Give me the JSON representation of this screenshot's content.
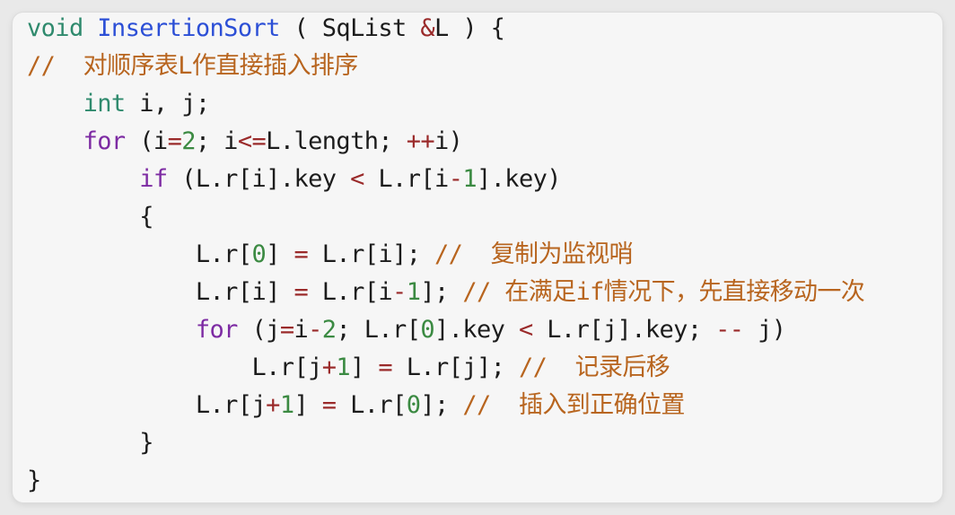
{
  "palette": {
    "keyword": "#7d2ba3",
    "type": "#2f8a6d",
    "function": "#2c4fd6",
    "number": "#3b8a42",
    "operator": "#9a2a2a",
    "comment": "#b8651f",
    "plain": "#1c1c1c",
    "background": "#f6f6f6"
  },
  "code": {
    "lines": [
      [
        [
          "void",
          "type"
        ],
        [
          " ",
          ""
        ],
        [
          "InsertionSort",
          "fn"
        ],
        [
          " ( SqList ",
          ""
        ],
        [
          "&",
          "op"
        ],
        [
          "L ) {",
          ""
        ]
      ],
      [
        [
          "//  对顺序表L作直接插入排序",
          "cm"
        ]
      ],
      [
        [
          "    ",
          ""
        ],
        [
          "int",
          "type"
        ],
        [
          " i, j;",
          ""
        ]
      ],
      [
        [
          "    ",
          ""
        ],
        [
          "for",
          "kw"
        ],
        [
          " (i",
          ""
        ],
        [
          "=",
          "op"
        ],
        [
          "2",
          "num"
        ],
        [
          "; i",
          ""
        ],
        [
          "<=",
          "op"
        ],
        [
          "L.length; ",
          ""
        ],
        [
          "++",
          "op"
        ],
        [
          "i)",
          ""
        ]
      ],
      [
        [
          "        ",
          ""
        ],
        [
          "if",
          "kw"
        ],
        [
          " (L.r[i].key ",
          ""
        ],
        [
          "<",
          "op"
        ],
        [
          " L.r[i",
          ""
        ],
        [
          "-",
          "op"
        ],
        [
          "1",
          "num"
        ],
        [
          "].key)",
          ""
        ]
      ],
      [
        [
          "        {",
          ""
        ]
      ],
      [
        [
          "            L.r[",
          ""
        ],
        [
          "0",
          "num"
        ],
        [
          "] ",
          ""
        ],
        [
          "=",
          "op"
        ],
        [
          " L.r[i]; ",
          ""
        ],
        [
          "//  复制为监视哨",
          "cm"
        ]
      ],
      [
        [
          "            L.r[i] ",
          ""
        ],
        [
          "=",
          "op"
        ],
        [
          " L.r[i",
          ""
        ],
        [
          "-",
          "op"
        ],
        [
          "1",
          "num"
        ],
        [
          "]; ",
          ""
        ],
        [
          "// 在满足if情况下，先直接移动一次",
          "cm"
        ]
      ],
      [
        [
          "            ",
          ""
        ],
        [
          "for",
          "kw"
        ],
        [
          " (j",
          ""
        ],
        [
          "=",
          "op"
        ],
        [
          "i",
          ""
        ],
        [
          "-",
          "op"
        ],
        [
          "2",
          "num"
        ],
        [
          "; L.r[",
          ""
        ],
        [
          "0",
          "num"
        ],
        [
          "].key ",
          ""
        ],
        [
          "<",
          "op"
        ],
        [
          " L.r[j].key; ",
          ""
        ],
        [
          "--",
          "op"
        ],
        [
          " j)",
          ""
        ]
      ],
      [
        [
          "                L.r[j",
          ""
        ],
        [
          "+",
          "op"
        ],
        [
          "1",
          "num"
        ],
        [
          "] ",
          ""
        ],
        [
          "=",
          "op"
        ],
        [
          " L.r[j]; ",
          ""
        ],
        [
          "//  记录后移",
          "cm"
        ]
      ],
      [
        [
          "            L.r[j",
          ""
        ],
        [
          "+",
          "op"
        ],
        [
          "1",
          "num"
        ],
        [
          "] ",
          ""
        ],
        [
          "=",
          "op"
        ],
        [
          " L.r[",
          ""
        ],
        [
          "0",
          "num"
        ],
        [
          "]; ",
          ""
        ],
        [
          "//  插入到正确位置",
          "cm"
        ]
      ],
      [
        [
          "        }",
          ""
        ]
      ],
      [
        [
          "}",
          ""
        ]
      ]
    ]
  }
}
